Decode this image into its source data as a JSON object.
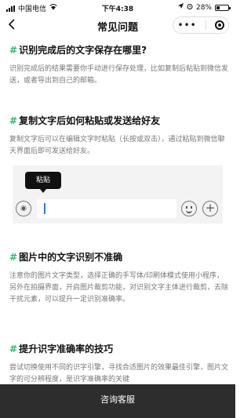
{
  "status_bar": {
    "carrier": "中国电信",
    "time": "下午4:38",
    "battery": "28%"
  },
  "nav": {
    "back_icon": "chevron-left-icon",
    "title": "常见问题"
  },
  "faqs": [
    {
      "title": "识别完成后的文字保存在哪里?",
      "body": "识别完成后的结果需要你手动进行保存处理，比如复制后粘贴到微信发送，或者导出到自己的邮箱。"
    },
    {
      "title": "复制文字后如何粘贴或发送给好友",
      "body": "复制文字后可以在编辑文字时粘贴（长按或双击），通过粘贴到微信聊天界面后即可发送给好友。"
    },
    {
      "title": "图片中的文字识别不准确",
      "body": "注意你的图片文字类型，选择正确的手写体/印刷体模式使用小程序，另外在拍摄界面，开启图片裁剪功能，对识别文字主体进行裁剪，去除干扰元素，可以提升一定识别准确率。"
    },
    {
      "title": "提升识字准确率的技巧",
      "body": "尝试切换使用不同的识字引擎，寻找合适图片的效果最佳引擎，图片文字的可分辨程度，是识字准确率的关键"
    }
  ],
  "demo": {
    "tooltip": "粘贴"
  },
  "footer": {
    "button": "咨询客服"
  },
  "colors": {
    "accent": "#2bb673",
    "footer_bg": "#2d2d2d",
    "caret": "#2f7bff"
  }
}
